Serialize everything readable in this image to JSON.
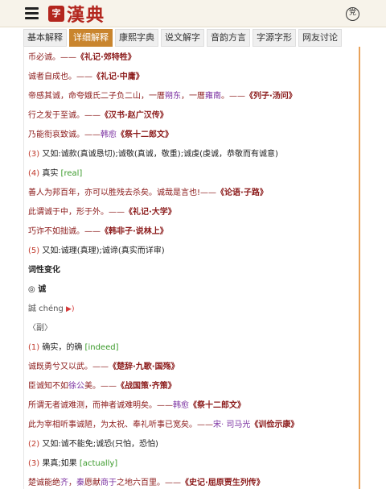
{
  "header": {
    "logo_seal": "字",
    "logo_text": "漢典",
    "user_icon_glyph": "党"
  },
  "tabs": [
    {
      "label": "基本解释"
    },
    {
      "label": "详细解释"
    },
    {
      "label": "康熙字典"
    },
    {
      "label": "说文解字"
    },
    {
      "label": "音韵方言"
    },
    {
      "label": "字源字形"
    },
    {
      "label": "网友讨论"
    }
  ],
  "active_tab": "详细解释",
  "lines": {
    "l1": {
      "text": "币必诚。",
      "dash": "——",
      "src": "《礼记·郊特牲》"
    },
    "l2": {
      "text": "诚者自成也。",
      "dash": "——",
      "src": "《礼记·中庸》"
    },
    "l3": {
      "a": "帝感其诚，命夸娥氏二子负二山，一厝",
      "b": "朔东",
      "c": "，一厝",
      "d": "雍南",
      "e": "。",
      "dash": "——",
      "src": "《列子·汤问》"
    },
    "l4": {
      "text": "行之发于至诚。",
      "dash": "——",
      "src": "《汉书·赵广汉传》"
    },
    "l5": {
      "text": "乃能衔哀致诚。",
      "dash": "——",
      "auth": "韩愈",
      "src": "《祭十二郎文》"
    },
    "l6": {
      "num": "(3)",
      "text": "又如:诚款(真诚恳切);诚敬(真诚，敬重);诚虔(虔诚，恭敬而有诚意)"
    },
    "l7": {
      "num": "(4)",
      "text": "真实",
      "en": "[real]"
    },
    "l8": {
      "text": "善人为邦百年，亦可以胜残去杀矣。诚哉是言也!",
      "dash": "——",
      "src": "《论语·子路》"
    },
    "l9": {
      "text": "此谓诚于中，形于外。",
      "dash": "——",
      "src": "《礼记·大学》"
    },
    "l10": {
      "text": "巧诈不如拙诚。",
      "dash": "——",
      "src": "《韩非子·说林上》"
    },
    "l11": {
      "num": "(5)",
      "text": "又如:诚理(真理);诚谛(真实而详审)"
    },
    "l12": {
      "text": "词性变化"
    },
    "l13": {
      "text": "◎ 诚"
    },
    "l14": {
      "text": "誠 chéng"
    },
    "l15": {
      "text": "〈副〉"
    },
    "l16": {
      "num": "(1)",
      "text": "确实，的确",
      "en": "[indeed]"
    },
    "l17": {
      "text": "诚既勇兮又以武。",
      "dash": "——",
      "src": "《楚辞·九歌·国殇》"
    },
    "l18": {
      "a": "臣诚知不如",
      "b": "徐公",
      "c": "美。",
      "dash": "——",
      "src": "《战国策·齐策》"
    },
    "l19": {
      "text": "所谓无者诚难测，而神者诚难明矣。",
      "dash": "——",
      "auth": "韩愈",
      "src": "《祭十二郎文》"
    },
    "l20": {
      "text": "此为宰相听事诚陋，为太祝、奉礼听事已宽矣。",
      "dash": "——",
      "auth": "宋· 司马光",
      "src": "《训俭示康》"
    },
    "l21": {
      "num": "(2)",
      "text": "又如:诚不能免;诚恐(只怕，恐怕)"
    },
    "l22": {
      "num": "(3)",
      "text": "果真;如果",
      "en": "[actually]"
    },
    "l23": {
      "a": "楚诚能绝",
      "b": "齐",
      "c": "，",
      "d": "秦",
      "e": "愿献",
      "f": "商于",
      "g": "之地六百里。",
      "dash": "——",
      "src": "《史记·屈原贾生列传》"
    }
  }
}
